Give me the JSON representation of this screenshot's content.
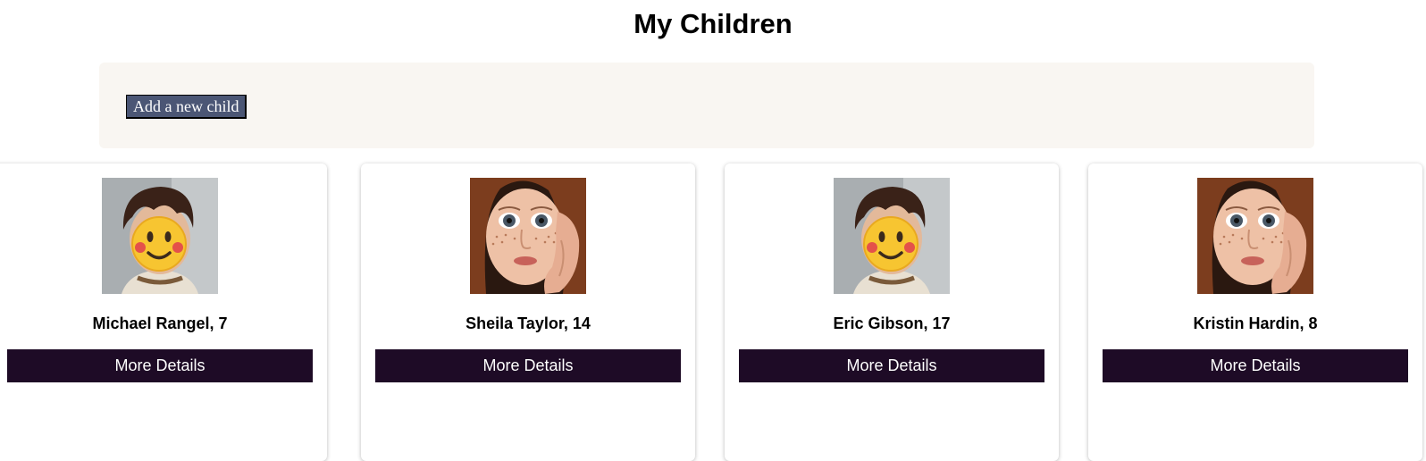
{
  "page": {
    "title": "My Children"
  },
  "add_panel": {
    "add_button_label": "Add a new child"
  },
  "children": [
    {
      "name_age": "Michael Rangel, 7",
      "photo": "boy-emoji-face-photo",
      "details_label": "More Details"
    },
    {
      "name_age": "Sheila Taylor, 14",
      "photo": "girl-freckles-photo",
      "details_label": "More Details"
    },
    {
      "name_age": "Eric Gibson, 17",
      "photo": "boy-emoji-face-photo",
      "details_label": "More Details"
    },
    {
      "name_age": "Kristin Hardin, 8",
      "photo": "girl-freckles-photo",
      "details_label": "More Details"
    }
  ],
  "colors": {
    "panel_bg": "#f9f6f2",
    "add_button_bg": "#4b5675",
    "details_button_bg": "#1e0b26"
  }
}
